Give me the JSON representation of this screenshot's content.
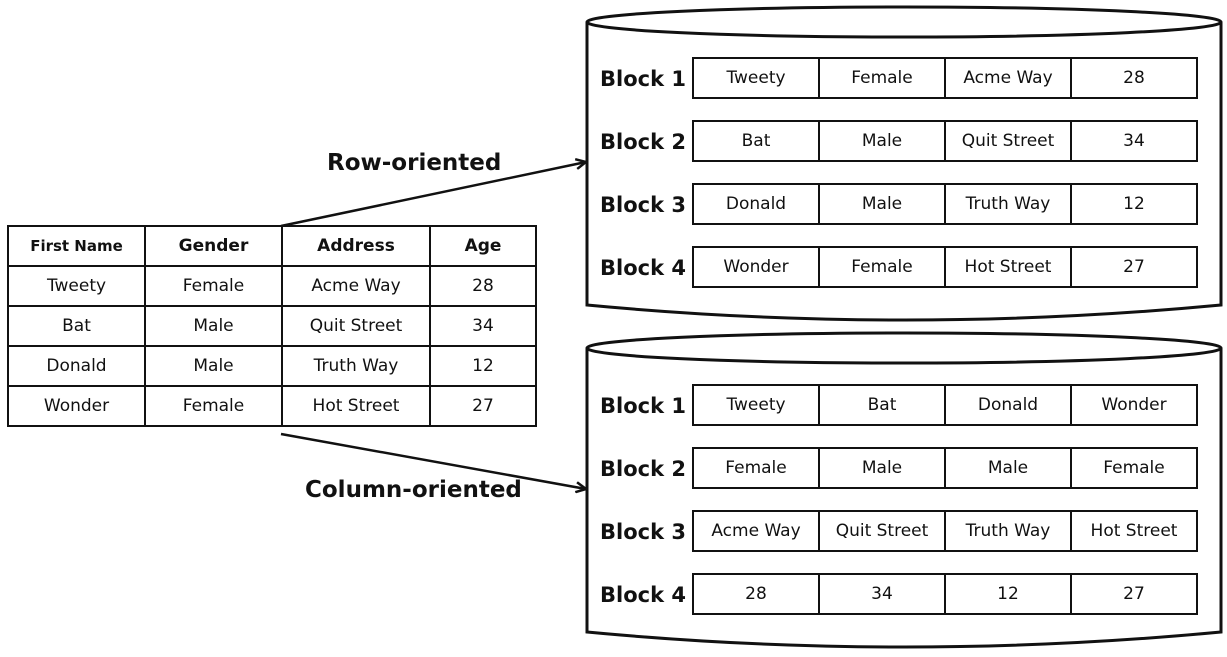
{
  "source_table": {
    "headers": [
      "First Name",
      "Gender",
      "Address",
      "Age"
    ],
    "rows": [
      [
        "Tweety",
        "Female",
        "Acme Way",
        "28"
      ],
      [
        "Bat",
        "Male",
        "Quit Street",
        "34"
      ],
      [
        "Donald",
        "Male",
        "Truth Way",
        "12"
      ],
      [
        "Wonder",
        "Female",
        "Hot Street",
        "27"
      ]
    ]
  },
  "labels": {
    "row_oriented": "Row-oriented",
    "column_oriented": "Column-oriented"
  },
  "row_store": {
    "blocks": [
      {
        "label": "Block 1",
        "cells": [
          "Tweety",
          "Female",
          "Acme Way",
          "28"
        ]
      },
      {
        "label": "Block 2",
        "cells": [
          "Bat",
          "Male",
          "Quit Street",
          "34"
        ]
      },
      {
        "label": "Block 3",
        "cells": [
          "Donald",
          "Male",
          "Truth Way",
          "12"
        ]
      },
      {
        "label": "Block 4",
        "cells": [
          "Wonder",
          "Female",
          "Hot Street",
          "27"
        ]
      }
    ]
  },
  "column_store": {
    "blocks": [
      {
        "label": "Block 1",
        "cells": [
          "Tweety",
          "Bat",
          "Donald",
          "Wonder"
        ]
      },
      {
        "label": "Block 2",
        "cells": [
          "Female",
          "Male",
          "Male",
          "Female"
        ]
      },
      {
        "label": "Block 3",
        "cells": [
          "Acme Way",
          "Quit Street",
          "Truth Way",
          "Hot Street"
        ]
      },
      {
        "label": "Block 4",
        "cells": [
          "28",
          "34",
          "12",
          "27"
        ]
      }
    ]
  }
}
